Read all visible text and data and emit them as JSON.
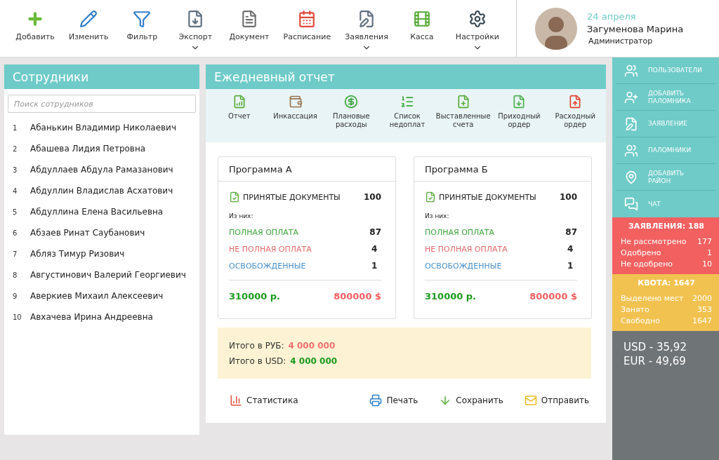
{
  "toolbar": [
    {
      "label": "Добавить",
      "dropdown": false
    },
    {
      "label": "Изменить",
      "dropdown": false
    },
    {
      "label": "Фильтр",
      "dropdown": false
    },
    {
      "label": "Экспорт",
      "dropdown": true
    },
    {
      "label": "Документ",
      "dropdown": false
    },
    {
      "label": "Расписание",
      "dropdown": false
    },
    {
      "label": "Заявления",
      "dropdown": true
    },
    {
      "label": "Касса",
      "dropdown": false
    },
    {
      "label": "Настройки",
      "dropdown": true
    }
  ],
  "user": {
    "date": "24 апреля",
    "name": "Загуменова Марина",
    "role": "Администратор"
  },
  "employees": {
    "title": "Сотрудники",
    "search": {
      "placeholder": "Поиск сотрудников"
    },
    "items": [
      {
        "number": "1",
        "name": "Абанькин Владимир Николаевич"
      },
      {
        "number": "2",
        "name": "Абашева Лидия Петровна"
      },
      {
        "number": "3",
        "name": "Абдуллаев Абдула Рамазанович"
      },
      {
        "number": "4",
        "name": "Абдуллин Владислав Асхатович"
      },
      {
        "number": "5",
        "name": "Абдуллина Елена Васильевна"
      },
      {
        "number": "6",
        "name": "Абзаев Ринат Саубанович"
      },
      {
        "number": "7",
        "name": "Абляз Тимур Ризович"
      },
      {
        "number": "8",
        "name": "Августинович Валерий Георгиевич"
      },
      {
        "number": "9",
        "name": "Аверкиев Михаил Алексеевич"
      },
      {
        "number": "10",
        "name": "Авхачева Ирина Андреевна"
      }
    ]
  },
  "report": {
    "title": "Ежедневный отчет",
    "actions": [
      {
        "label": "Отчет"
      },
      {
        "label": "Инкассация"
      },
      {
        "label": "Плановые расходы"
      },
      {
        "label": "Список недоплат"
      },
      {
        "label": "Выставленные счета"
      },
      {
        "label": "Приходный ордер"
      },
      {
        "label": "Расходный ордер"
      }
    ],
    "programs": [
      {
        "title": "Программа А",
        "docs_label": "ПРИНЯТЫЕ ДОКУМЕНТЫ",
        "docs_count": "100",
        "subtitle": "Из них:",
        "rows": [
          {
            "label": "ПОЛНАЯ ОПЛАТА",
            "value": "87",
            "color": "#3aa63a"
          },
          {
            "label": "НЕ ПОЛНАЯ ОПЛАТА",
            "value": "4",
            "color": "#e06a6a"
          },
          {
            "label": "ОСВОБОЖДЕННЫЕ",
            "value": "1",
            "color": "#4a90c8"
          }
        ],
        "sum_rub": "310000 р.",
        "sum_usd": "800000 $"
      },
      {
        "title": "Программа Б",
        "docs_label": "ПРИНЯТЫЕ ДОКУМЕНТЫ",
        "docs_count": "100",
        "subtitle": "Из них:",
        "rows": [
          {
            "label": "ПОЛНАЯ ОПЛАТА",
            "value": "87",
            "color": "#3aa63a"
          },
          {
            "label": "НЕ ПОЛНАЯ ОПЛАТА",
            "value": "4",
            "color": "#e06a6a"
          },
          {
            "label": "ОСВОБОЖДЕННЫЕ",
            "value": "1",
            "color": "#4a90c8"
          }
        ],
        "sum_rub": "310000 р.",
        "sum_usd": "800000 $"
      }
    ],
    "totals": [
      {
        "label": "Итого в РУБ:",
        "value": "4 000 000",
        "color": "#f07070"
      },
      {
        "label": "Итого в USD:",
        "value": "4 000 000",
        "color": "#1c9a1c"
      }
    ],
    "footer": [
      {
        "label": "Статистика"
      },
      {
        "label": "Печать"
      },
      {
        "label": "Сохранить"
      },
      {
        "label": "Отправить"
      }
    ]
  },
  "sidebar": {
    "menu": [
      {
        "label": "ПОЛЬЗОВАТЕЛИ"
      },
      {
        "label": "ДОБАВИТЬ ПАЛОМНИКА"
      },
      {
        "label": "ЗАЯВЛЕНИЕ"
      },
      {
        "label": "ПАЛОМНИКИ"
      },
      {
        "label": "ДОБАВИТЬ РАЙОН"
      },
      {
        "label": "ЧАТ"
      }
    ],
    "stats": [
      {
        "title": "ЗАЯВЛЕНИЯ: 188",
        "color": "#f26060",
        "rows": [
          {
            "label": "Не рассмотрено",
            "value": "177"
          },
          {
            "label": "Одобрено",
            "value": "1"
          },
          {
            "label": "Не одобрено",
            "value": "10"
          }
        ]
      },
      {
        "title": "КВОТА: 1647",
        "color": "#f2c250",
        "rows": [
          {
            "label": "Выделено мест",
            "value": "2000"
          },
          {
            "label": "Занято",
            "value": "353"
          },
          {
            "label": "Свободно",
            "value": "1647"
          }
        ]
      }
    ],
    "rates": [
      "USD - 35,92",
      "EUR - 49,69"
    ]
  }
}
